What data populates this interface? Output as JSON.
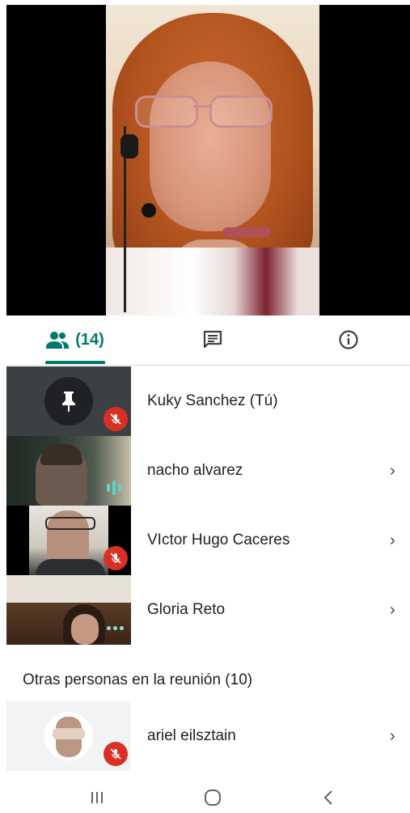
{
  "tabs": {
    "people_count": "(14)",
    "chat_icon": "chat-icon",
    "info_icon": "info-icon"
  },
  "participants": [
    {
      "name": "Kuky Sanchez (Tú)",
      "status": "muted",
      "thumb": "pin-avatar"
    },
    {
      "name": "nacho alvarez",
      "status": "speaking",
      "thumb": "video"
    },
    {
      "name": "VIctor Hugo Caceres",
      "status": "muted",
      "thumb": "video"
    },
    {
      "name": "Gloria Reto",
      "status": "more",
      "thumb": "video"
    }
  ],
  "others": {
    "title": "Otras personas en la reunión (10)",
    "items": [
      {
        "name": "ariel eilsztain",
        "status": "muted",
        "thumb": "avatar"
      }
    ]
  },
  "colors": {
    "accent": "#00796b",
    "mute_red": "#d93025",
    "speaking": "#5bd3c4"
  }
}
